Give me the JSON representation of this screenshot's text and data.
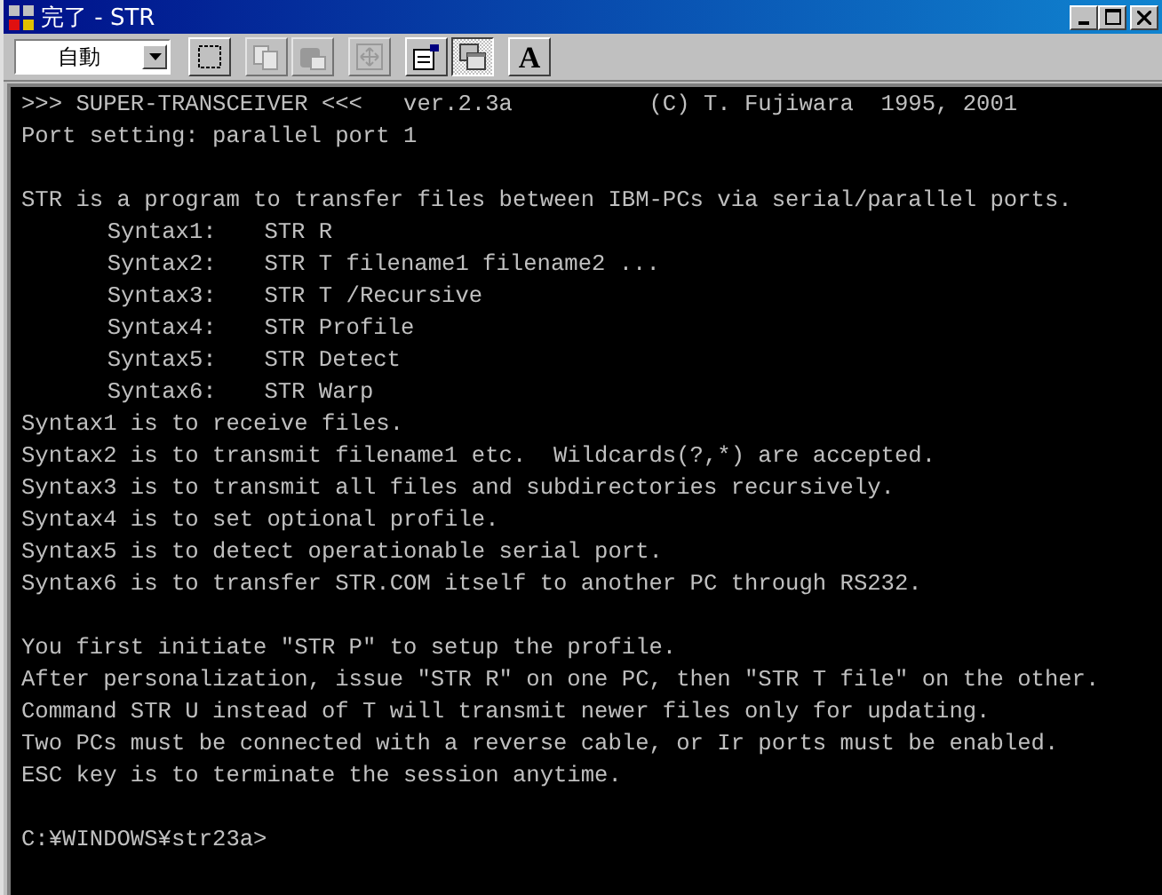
{
  "window": {
    "title": "完了 - STR"
  },
  "toolbar": {
    "font_size": {
      "value": "自動"
    },
    "buttons": [
      {
        "kind": "mark",
        "disabled": false,
        "selected": false
      },
      {
        "kind": "copy",
        "disabled": true,
        "selected": false
      },
      {
        "kind": "paste",
        "disabled": true,
        "selected": false
      },
      {
        "kind": "fullscreen",
        "disabled": true,
        "selected": false
      },
      {
        "kind": "properties",
        "disabled": false,
        "selected": false
      },
      {
        "kind": "background",
        "disabled": false,
        "selected": true
      },
      {
        "kind": "font",
        "label": "A",
        "disabled": false,
        "selected": false
      }
    ]
  },
  "console": {
    "blocks": [
      [
        {
          "kind": "text",
          "text": ">>> SUPER-TRANSCEIVER <<<   ver.2.3a          (C) T. Fujiwara  1995, 2001"
        },
        {
          "kind": "text",
          "text": "Port setting: parallel port 1"
        }
      ],
      [
        {
          "kind": "text",
          "text": "STR is a program to transfer files between IBM-PCs via serial/parallel ports."
        },
        {
          "kind": "syntax",
          "label": "Syntax1:",
          "command": "STR R"
        },
        {
          "kind": "syntax",
          "label": "Syntax2:",
          "command": "STR T filename1 filename2 ..."
        },
        {
          "kind": "syntax",
          "label": "Syntax3:",
          "command": "STR T /Recursive"
        },
        {
          "kind": "syntax",
          "label": "Syntax4:",
          "command": "STR Profile"
        },
        {
          "kind": "syntax",
          "label": "Syntax5:",
          "command": "STR Detect"
        },
        {
          "kind": "syntax",
          "label": "Syntax6:",
          "command": "STR Warp"
        },
        {
          "kind": "text",
          "text": "Syntax1 is to receive files."
        },
        {
          "kind": "text",
          "text": "Syntax2 is to transmit filename1 etc.  Wildcards(?,*) are accepted."
        },
        {
          "kind": "text",
          "text": "Syntax3 is to transmit all files and subdirectories recursively."
        },
        {
          "kind": "text",
          "text": "Syntax4 is to set optional profile."
        },
        {
          "kind": "text",
          "text": "Syntax5 is to detect operationable serial port."
        },
        {
          "kind": "text",
          "text": "Syntax6 is to transfer STR.COM itself to another PC through RS232."
        }
      ],
      [
        {
          "kind": "text",
          "text": "You first initiate \"STR P\" to setup the profile."
        },
        {
          "kind": "text",
          "text": "After personalization, issue \"STR R\" on one PC, then \"STR T file\" on the other."
        },
        {
          "kind": "text",
          "text": "Command STR U instead of T will transmit newer files only for updating."
        },
        {
          "kind": "text",
          "text": "Two PCs must be connected with a reverse cable, or Ir ports must be enabled."
        },
        {
          "kind": "text",
          "text": "ESC key is to terminate the session anytime."
        }
      ],
      [
        {
          "kind": "prompt",
          "text": "C:¥WINDOWS¥str23a>"
        }
      ]
    ]
  }
}
